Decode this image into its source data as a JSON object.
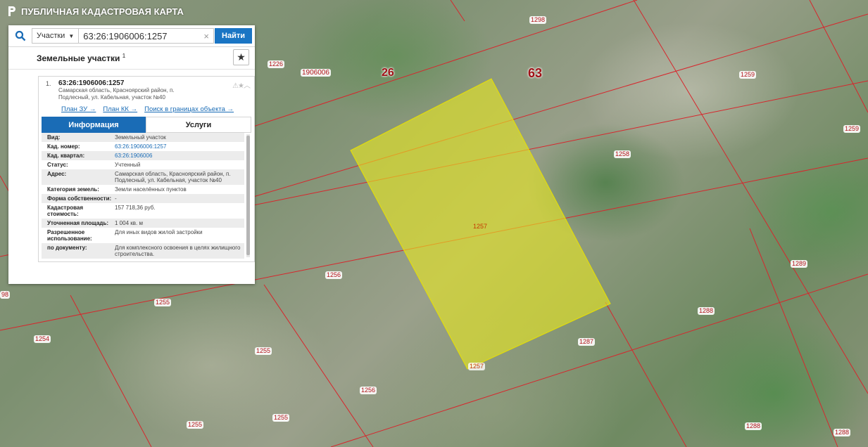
{
  "app": {
    "title": "ПУБЛИЧНАЯ КАДАСТРОВАЯ КАРТА"
  },
  "search": {
    "type_label": "Участки",
    "query": "63:26:1906006:1257",
    "find_label": "Найти",
    "clear_symbol": "×"
  },
  "results": {
    "title": "Земельные участки",
    "count": "1",
    "item": {
      "index": "1.",
      "cad_number": "63:26:1906006:1257",
      "address": "Самарская область, Красноярский район, п. Подлесный, ул. Кабельная, участок №40",
      "links": [
        "План ЗУ →",
        "План КК →",
        "Поиск в границах объекта →"
      ],
      "tabs": [
        "Информация",
        "Услуги"
      ],
      "properties": [
        {
          "k": "Вид:",
          "v": "Земельный участок"
        },
        {
          "k": "Кад. номер:",
          "v": "63:26:1906006:1257"
        },
        {
          "k": "Кад. квартал:",
          "v": "63:26:1906006"
        },
        {
          "k": "Статус:",
          "v": "Учтенный"
        },
        {
          "k": "Адрес:",
          "v": "Самарская область, Красноярский район, п. Подлесный, ул. Кабельная, участок №40"
        },
        {
          "k": "Категория земель:",
          "v": "Земли населённых пунктов"
        },
        {
          "k": "Форма собственности:",
          "v": "-"
        },
        {
          "k": "Кадастровая стоимость:",
          "v": "157 718,36 руб."
        },
        {
          "k": "Уточненная площадь:",
          "v": "1 004 кв. м"
        },
        {
          "k": "Разрешенное использование:",
          "v": "Для иных видов жилой застройки"
        },
        {
          "k": "по документу:",
          "v": "Для комплексного освоения в целях жилищного строительства."
        }
      ]
    }
  },
  "map": {
    "region_label": "63",
    "district_label": "26",
    "quarter_label": "1906006",
    "selected_label": "1257",
    "selected_label_bottom": "1257",
    "parcels": [
      "1298",
      "1226",
      "1259",
      "1259",
      "1258",
      "1289",
      "1288",
      "1287",
      "1256",
      "1255",
      "1254",
      "1255",
      "1256",
      "1255",
      "1255",
      "1288",
      "1288",
      "98"
    ]
  },
  "colors": {
    "accent": "#1a6cb6",
    "parcel_border": "#d7262c",
    "selected_fill": "#e6e622"
  }
}
